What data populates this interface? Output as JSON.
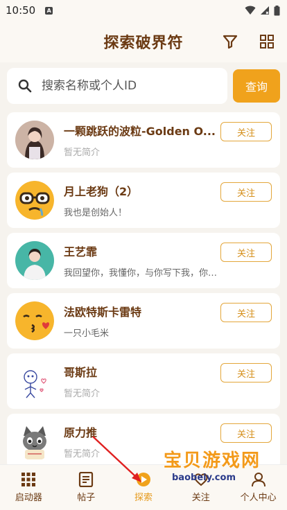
{
  "status_bar": {
    "time": "10:50",
    "notif_label": "A"
  },
  "header": {
    "title": "探索破界符"
  },
  "search": {
    "placeholder": "搜索名称或个人ID",
    "button_label": "查询"
  },
  "users": [
    {
      "name": "一颗跳跃的波粒-Golden O...",
      "bio": "暂无简介",
      "bio_muted": true,
      "follow_label": "关注",
      "avatar": "photo-girl"
    },
    {
      "name": "月上老狗（2）",
      "bio": "我也是创始人！",
      "bio_muted": false,
      "follow_label": "关注",
      "avatar": "emoji-glasses"
    },
    {
      "name": "王艺霏",
      "bio": "我回望你，我懂你，与你写下我，你将会替我...",
      "bio_muted": false,
      "follow_label": "关注",
      "avatar": "photo-woman"
    },
    {
      "name": "法欧特斯卡雷特",
      "bio": "一只小毛米",
      "bio_muted": false,
      "follow_label": "关注",
      "avatar": "emoji-kiss"
    },
    {
      "name": "哥斯拉",
      "bio": "暂无简介",
      "bio_muted": true,
      "follow_label": "关注",
      "avatar": "sketch-figure"
    },
    {
      "name": "原力推",
      "bio": "暂无简介",
      "bio_muted": true,
      "follow_label": "关注",
      "avatar": "cartoon-cat"
    }
  ],
  "tabbar": {
    "tabs": [
      {
        "label": "启动器",
        "icon": "grid-icon",
        "active": false
      },
      {
        "label": "帖子",
        "icon": "document-icon",
        "active": false
      },
      {
        "label": "探索",
        "icon": "explore-icon",
        "active": true
      },
      {
        "label": "关注",
        "icon": "heart-icon",
        "active": false
      },
      {
        "label": "个人中心",
        "icon": "person-icon",
        "active": false
      }
    ]
  },
  "watermark": {
    "text": "宝贝游戏网",
    "url": "baobeiy.com"
  },
  "colors": {
    "accent": "#f0a21c",
    "brand_text": "#6b3a13",
    "background": "#f6f3ee",
    "arrow": "#e02020"
  }
}
